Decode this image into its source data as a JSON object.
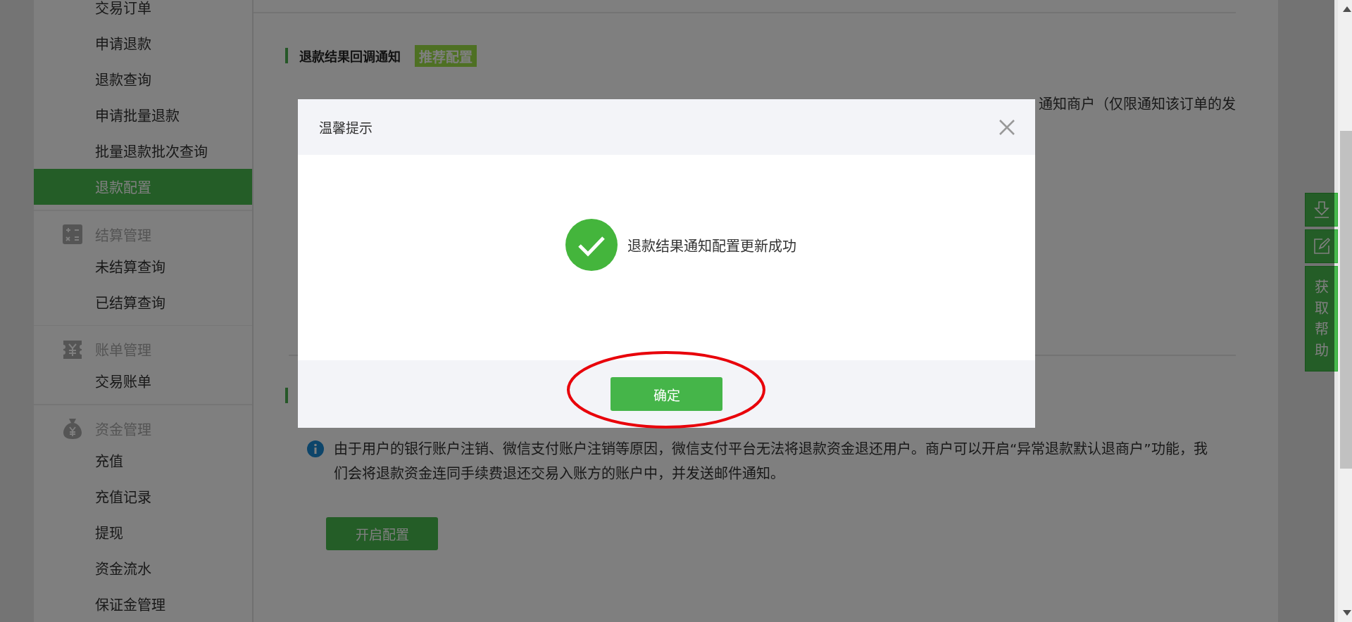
{
  "sidebar": {
    "items": [
      {
        "kind": "link",
        "label": "交易订单",
        "selected": false
      },
      {
        "kind": "link",
        "label": "申请退款",
        "selected": false
      },
      {
        "kind": "link",
        "label": "退款查询",
        "selected": false
      },
      {
        "kind": "link",
        "label": "申请批量退款",
        "selected": false
      },
      {
        "kind": "link",
        "label": "批量退款批次查询",
        "selected": false
      },
      {
        "kind": "link",
        "label": "退款配置",
        "selected": true
      },
      {
        "kind": "group",
        "label": "结算管理"
      },
      {
        "kind": "link",
        "label": "未结算查询",
        "selected": false
      },
      {
        "kind": "link",
        "label": "已结算查询",
        "selected": false
      },
      {
        "kind": "group",
        "label": "账单管理"
      },
      {
        "kind": "link",
        "label": "交易账单",
        "selected": false
      },
      {
        "kind": "group",
        "label": "资金管理"
      },
      {
        "kind": "link",
        "label": "充值",
        "selected": false
      },
      {
        "kind": "link",
        "label": "充值记录",
        "selected": false
      },
      {
        "kind": "link",
        "label": "提现",
        "selected": false
      },
      {
        "kind": "link",
        "label": "资金流水",
        "selected": false
      },
      {
        "kind": "link",
        "label": "保证金管理",
        "selected": false
      }
    ]
  },
  "sections": [
    {
      "title": "退款结果回调通知",
      "badge": "推荐配置",
      "info_text": "通知商户（仅限通知该订单的发"
    },
    {
      "info_text": "由于用户的银行账户注销、微信支付账户注销等原因，微信支付平台无法将退款资金退还用户。商户可以开启“异常退款默认退商户”功能，我们会将退款资金连同手续费退还交易入账方的账户中，并发送邮件通知。",
      "button": "开启配置"
    }
  ],
  "side_tools": {
    "help_label": "获取帮助"
  },
  "dialog": {
    "title": "温馨提示",
    "message": "退款结果通知配置更新成功",
    "button": "确定"
  }
}
